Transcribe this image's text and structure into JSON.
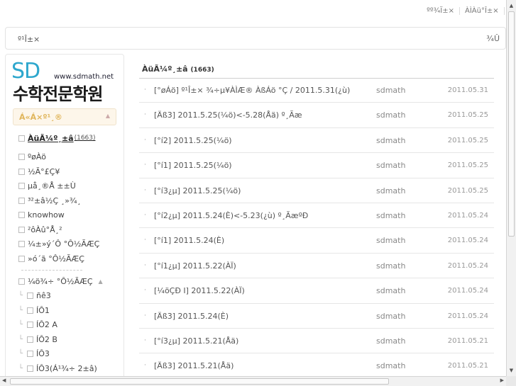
{
  "topnav": {
    "item1": "ºº¾Ï±×",
    "item2": "ÀÌÀü°Î±×",
    "item3": "¿"
  },
  "search": {
    "placeholder_text": "º¹Î±×",
    "button_label": "¾Û"
  },
  "logo": {
    "sd": "SD",
    "url": "www.sdmath.net",
    "name": "수학전문학원"
  },
  "sidebar": {
    "category_label": "Á«Á×º¹¸®",
    "collapse_icon": "triangle-up-icon",
    "items": [
      {
        "label": "ÀüÃ¼º¸±â",
        "count": "(1663)",
        "active": true
      },
      {
        "label": "ºøÀö"
      },
      {
        "label": "½Ã°£Ç¥"
      },
      {
        "label": "µå¸®Å ±±Ù"
      },
      {
        "label": "³²±â½Ç ¸»¾¸"
      },
      {
        "label": "knowhow"
      },
      {
        "label": "²ôÀû°Å¸²"
      },
      {
        "label": "¼±»ý´Ô °Ô½ÃÆÇ"
      },
      {
        "label": "»ó´ã °Ô½ÃÆÇ"
      }
    ],
    "group": {
      "label": "¼ö¾÷ °Ô½ÃÆÇ",
      "children": [
        "ñê3",
        "ÍÔ1",
        "ÍÔ2 A",
        "ÍÔ2 B",
        "ÍÔ3",
        "ÍÔ3(Á¹¾÷ 2±â)"
      ]
    }
  },
  "main": {
    "title": "ÀüÃ¼º¸±â",
    "count": "(1663)",
    "posts": [
      {
        "title": "[°øÁö] º¹Î±× ¾÷µ¥ÀÌÆ® ÀßÁö °Ç / 2011.5.31(¿ù)",
        "author": "sdmath",
        "date": "2011.05.31"
      },
      {
        "title": "[Äß3] 2011.5.25(¼ö)<-5.28(Åä) º¸Ãæ",
        "author": "sdmath",
        "date": "2011.05.25"
      },
      {
        "title": "[°í2] 2011.5.25(¼ö)",
        "author": "sdmath",
        "date": "2011.05.25"
      },
      {
        "title": "[°í1] 2011.5.25(¼ö)",
        "author": "sdmath",
        "date": "2011.05.25"
      },
      {
        "title": "[°í3¿µ] 2011.5.25(¼ö)",
        "author": "sdmath",
        "date": "2011.05.25"
      },
      {
        "title": "[°í2¿µ] 2011.5.24(È)<-5.23(¿ù) º¸ÃæºÐ",
        "author": "sdmath",
        "date": "2011.05.24"
      },
      {
        "title": "[°í1] 2011.5.24(È)",
        "author": "sdmath",
        "date": "2011.05.24"
      },
      {
        "title": "[°í1¿µ] 2011.5.22(ÀÏ)",
        "author": "sdmath",
        "date": "2011.05.24"
      },
      {
        "title": "[¼öÇÐ I] 2011.5.22(ÀÏ)",
        "author": "sdmath",
        "date": "2011.05.24"
      },
      {
        "title": "[Äß3] 2011.5.24(È)",
        "author": "sdmath",
        "date": "2011.05.24"
      },
      {
        "title": "[°í3¿µ] 2011.5.21(Åä)",
        "author": "sdmath",
        "date": "2011.05.21"
      },
      {
        "title": "[Äß3] 2011.5.21(Åä)",
        "author": "sdmath",
        "date": "2011.05.21"
      }
    ]
  },
  "colors": {
    "accent": "#2ea7cd",
    "category_bg": "#fdf6ea",
    "category_text": "#e0b55a"
  }
}
